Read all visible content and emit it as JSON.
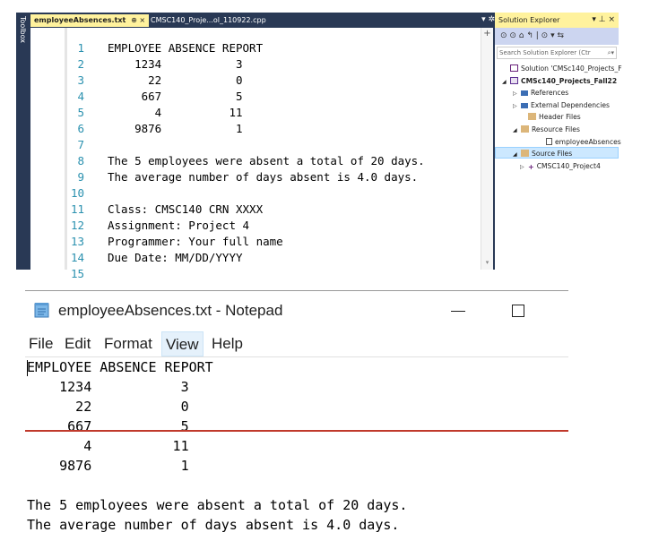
{
  "vs": {
    "toolbox_label": "Toolbox",
    "tabs": {
      "active": "employeeAbsences.txt",
      "active_pin": "⊕ ×",
      "inactive": "CMSC140_Proje...ol_110922.cpp"
    },
    "tab_controls": "▾ ✲",
    "line_numbers": [
      "1",
      "2",
      "3",
      "4",
      "5",
      "6",
      "7",
      "8",
      "9",
      "10",
      "11",
      "12",
      "13",
      "14",
      "15"
    ],
    "code_lines": [
      "EMPLOYEE ABSENCE REPORT",
      "    1234           3",
      "      22           0",
      "     667           5",
      "       4          11",
      "    9876           1",
      "",
      "The 5 employees were absent a total of 20 days.",
      "The average number of days absent is 4.0 days.",
      "",
      "Class: CMSC140 CRN XXXX",
      "Assignment: Project 4",
      "Programmer: Your full name",
      "Due Date: MM/DD/YYYY",
      ""
    ],
    "scroll_up": "+",
    "scroll_down": "▾"
  },
  "solution_explorer": {
    "title": "Solution Explorer",
    "title_icons": "▾ ⊥ ×",
    "toolbar": "⊙ ⊙ ⌂ ↰ | ⊙ ▾ ⇆",
    "search_placeholder": "Search Solution Explorer (Ctr",
    "search_icon": "⌕▾",
    "items": [
      {
        "arrow": "",
        "icon": "solution-icon",
        "label": "Solution 'CMSc140_Projects_F"
      },
      {
        "arrow": "◢",
        "icon": "project-icon",
        "label": "CMSc140_Projects_Fall22"
      },
      {
        "arrow": "▷",
        "icon": "references-icon",
        "label": "References"
      },
      {
        "arrow": "▷",
        "icon": "external-deps-icon",
        "label": "External Dependencies"
      },
      {
        "arrow": "",
        "icon": "folder-icon",
        "label": "Header Files"
      },
      {
        "arrow": "◢",
        "icon": "folder-icon",
        "label": "Resource Files"
      },
      {
        "arrow": "",
        "icon": "text-file-icon",
        "label": "employeeAbsences"
      },
      {
        "arrow": "◢",
        "icon": "folder-icon",
        "label": "Source Files"
      },
      {
        "arrow": "▷",
        "icon": "cpp-file-icon",
        "label": "CMSC140_Project4"
      }
    ]
  },
  "notepad": {
    "title": "employeeAbsences.txt - Notepad",
    "menu": [
      "File",
      "Edit",
      "Format",
      "View",
      "Help"
    ],
    "lines": [
      "EMPLOYEE ABSENCE REPORT",
      "    1234           3",
      "      22           0",
      "     667           5",
      "       4          11",
      "    9876           1",
      "",
      "The 5 employees were absent a total of 20 days.",
      "The average number of days absent is 4.0 days."
    ],
    "colors": {
      "red_strike": "#c0392b",
      "view_highlight": "#e5f1fb"
    }
  }
}
